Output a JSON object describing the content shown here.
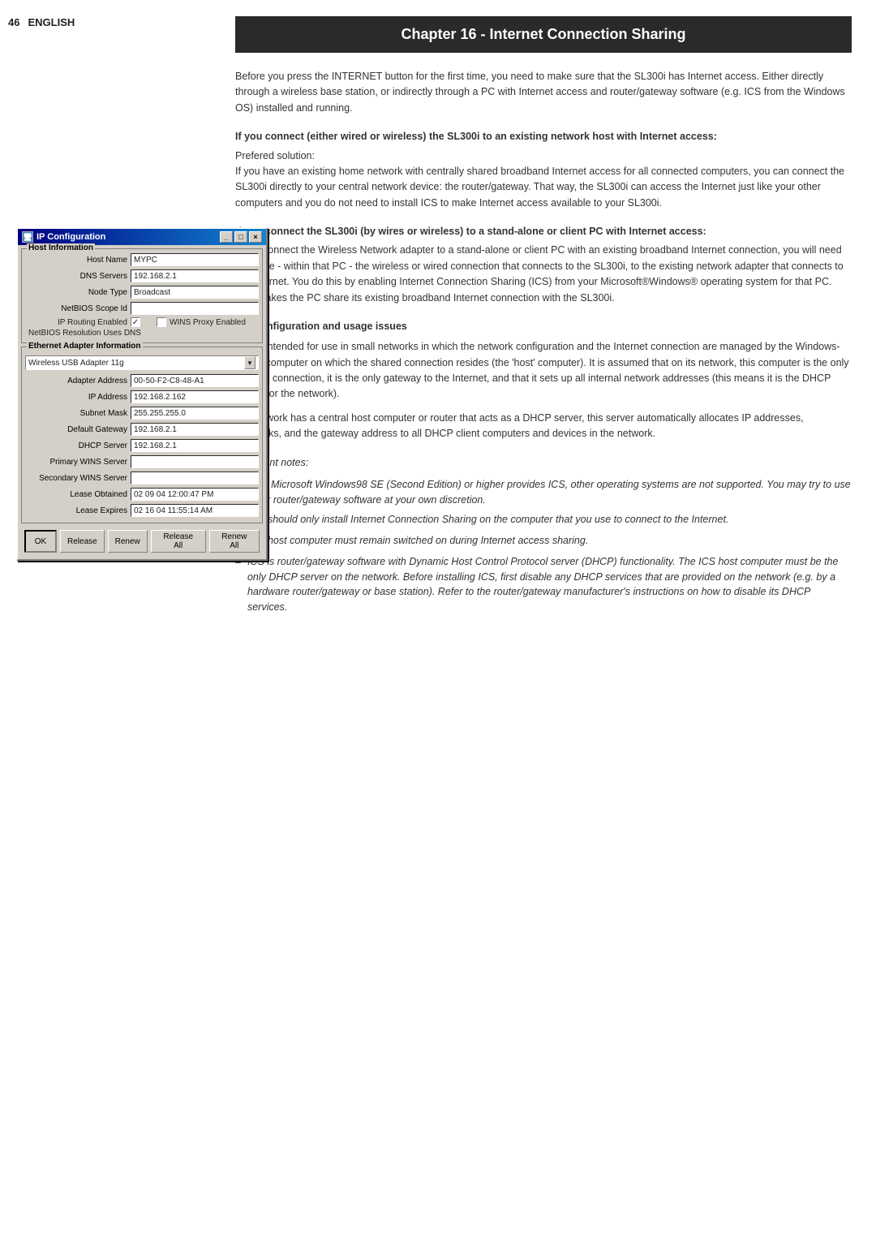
{
  "sidebar": {
    "page_number": "46",
    "page_label": "ENGLISH"
  },
  "dialog": {
    "title": "IP Configuration",
    "titlebar_icon": "🖥",
    "buttons": {
      "minimize": "_",
      "maximize": "□",
      "close": "×"
    },
    "host_info_label": "Host Information",
    "fields": {
      "host_name_label": "Host Name",
      "host_name_value": "MYPC",
      "dns_servers_label": "DNS Servers",
      "dns_servers_value": "192.168.2.1",
      "node_type_label": "Node Type",
      "node_type_value": "Broadcast",
      "netbios_scope_label": "NetBIOS Scope Id",
      "netbios_scope_value": "",
      "ip_routing_label": "IP Routing Enabled",
      "ip_routing_checked": true,
      "wins_proxy_label": "WINS Proxy Enabled",
      "wins_proxy_checked": false,
      "netbios_dns_label": "NetBIOS Resolution Uses DNS"
    },
    "adapter_section_label": "Ethernet Adapter Information",
    "adapter_dropdown_value": "Wireless USB Adapter 11g",
    "adapter_fields": {
      "adapter_address_label": "Adapter Address",
      "adapter_address_value": "00-50-F2-C8-48-A1",
      "ip_address_label": "IP Address",
      "ip_address_value": "192.168.2.162",
      "subnet_mask_label": "Subnet Mask",
      "subnet_mask_value": "255.255.255.0",
      "default_gateway_label": "Default Gateway",
      "default_gateway_value": "192.168.2.1",
      "dhcp_server_label": "DHCP Server",
      "dhcp_server_value": "192.168.2.1",
      "primary_wins_label": "Primary WINS Server",
      "primary_wins_value": "",
      "secondary_wins_label": "Secondary WINS Server",
      "secondary_wins_value": "",
      "lease_obtained_label": "Lease Obtained",
      "lease_obtained_value": "02 09 04 12:00:47 PM",
      "lease_expires_label": "Lease Expires",
      "lease_expires_value": "02 16 04 11:55:14 AM"
    },
    "action_buttons": {
      "ok": "OK",
      "release": "Release",
      "renew": "Renew",
      "release_all": "Release All",
      "renew_all": "Renew All"
    }
  },
  "chapter": {
    "title": "Chapter 16 - Internet Connection Sharing"
  },
  "content": {
    "intro_paragraph": "Before you press the INTERNET button for the first time, you need to make sure that the SL300i has Internet access. Either directly through a wireless base station, or indirectly through a PC with Internet access and router/gateway software (e.g. ICS from the Windows OS) installed and running.",
    "section1_heading": "If you connect (either wired or wireless) the SL300i to an existing network host with Internet access:",
    "section1_subheading": "Prefered solution:",
    "section1_paragraph": "If you have an existing home network with centrally shared broadband Internet access for all connected computers, you can connect the SL300i directly to your central network device: the router/gateway. That way, the SL300i can access the Internet just like your other computers and you do not need to install ICS to make Internet access available to your SL300i.",
    "section2_heading": "If you connect the SL300i (by wires or wireless) to a stand-alone or client PC with Internet access:",
    "section2_paragraph": "If you connect the Wireless Network adapter to a stand-alone or client PC with an existing broadband Internet connection, you will need to bridge - within that PC - the wireless or wired connection that connects to the SL300i, to the existing network adapter that connects to the Internet. You do this by enabling Internet Connection Sharing (ICS) from your Microsoft®Windows® operating system for that PC. This makes the PC share its existing broadband Internet connection with the SL300i.",
    "ics_heading": "ICS configuration and usage issues",
    "ics_paragraph1": "ICS is intended for use in small networks in which the network configuration and the Internet connection are managed by the Windows-based computer on which the shared connection resides (the 'host' computer). It is assumed that on its network, this computer is the only Internet connection, it is the only gateway to the Internet, and that it sets up all internal network addresses (this means it is the DHCP server for the network).",
    "ics_paragraph2": "If a network has a central host computer or router that acts as a DHCP server, this server automatically allocates IP addresses, netmasks, and the gateway address to all DHCP client computers and devices in the network.",
    "important_notes_label": "Important notes:",
    "notes": [
      "Only Microsoft Windows98 SE (Second Edition) or higher provides ICS, other operating systems are not supported. You may try to use other router/gateway software at your own discretion.",
      "You should only install Internet Connection Sharing on the computer that you use to connect to the Internet.",
      "The host computer must remain switched on during Internet access sharing.",
      "ICS is router/gateway software with Dynamic Host Control Protocol server (DHCP) functionality. The ICS host computer must be the only DHCP server on the network. Before installing ICS, first disable any DHCP services that are provided on the network (e.g. by a hardware router/gateway or base station). Refer to the router/gateway manufacturer's instructions on how to disable its DHCP services."
    ]
  }
}
